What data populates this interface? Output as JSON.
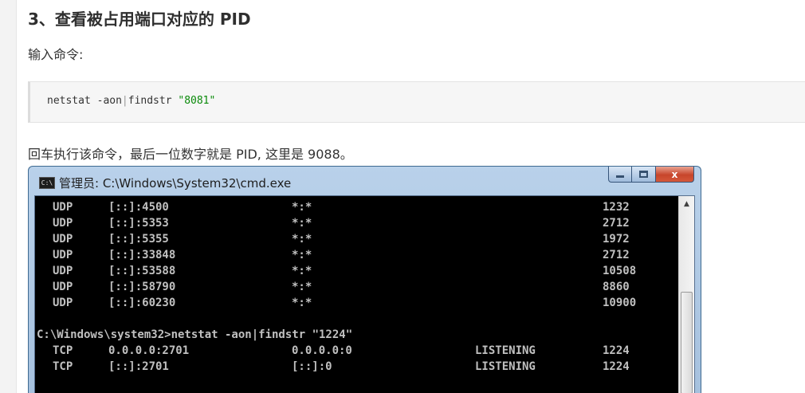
{
  "article": {
    "heading": "3、查看被占用端口对应的 PID",
    "intro": "输入命令:",
    "code": {
      "cmd": "netstat -aon",
      "pipe": "|",
      "tool": "findstr ",
      "arg": "\"8081\""
    },
    "result_text": "回车执行该命令，最后一位数字就是 PID, 这里是 9088。"
  },
  "cmd_window": {
    "icon_label": "C:\\",
    "title": "管理员: C:\\Windows\\System32\\cmd.exe",
    "min_icon": "minimize-icon",
    "max_icon": "maximize-icon",
    "close_icon": "close-icon",
    "close_glyph": "x",
    "scroll_up_glyph": "▲",
    "rows": [
      {
        "proto": "UDP",
        "local": "[::]:4500",
        "foreign": "*:*",
        "state": "",
        "pid": "1232"
      },
      {
        "proto": "UDP",
        "local": "[::]:5353",
        "foreign": "*:*",
        "state": "",
        "pid": "2712"
      },
      {
        "proto": "UDP",
        "local": "[::]:5355",
        "foreign": "*:*",
        "state": "",
        "pid": "1972"
      },
      {
        "proto": "UDP",
        "local": "[::]:33848",
        "foreign": "*:*",
        "state": "",
        "pid": "2712"
      },
      {
        "proto": "UDP",
        "local": "[::]:53588",
        "foreign": "*:*",
        "state": "",
        "pid": "10508"
      },
      {
        "proto": "UDP",
        "local": "[::]:58790",
        "foreign": "*:*",
        "state": "",
        "pid": "8860"
      },
      {
        "proto": "UDP",
        "local": "[::]:60230",
        "foreign": "*:*",
        "state": "",
        "pid": "10900"
      }
    ],
    "prompt_line": "C:\\Windows\\system32>netstat -aon|findstr \"1224\"",
    "result_rows": [
      {
        "proto": "TCP",
        "local": "0.0.0.0:2701",
        "foreign": "0.0.0.0:0",
        "state": "LISTENING",
        "pid": "1224"
      },
      {
        "proto": "TCP",
        "local": "[::]:2701",
        "foreign": "[::]:0",
        "state": "LISTENING",
        "pid": "1224"
      }
    ]
  }
}
